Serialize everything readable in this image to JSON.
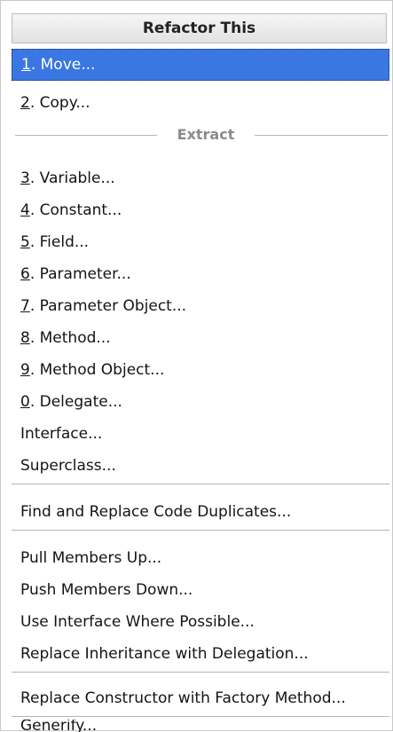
{
  "menu": {
    "title": "Refactor This",
    "items": [
      {
        "hotkey": "1",
        "label": ". Move..."
      },
      {
        "hotkey": "2",
        "label": ". Copy..."
      },
      {
        "hotkey": "3",
        "label": ". Variable..."
      },
      {
        "hotkey": "4",
        "label": ". Constant..."
      },
      {
        "hotkey": "5",
        "label": ". Field..."
      },
      {
        "hotkey": "6",
        "label": ". Parameter..."
      },
      {
        "hotkey": "7",
        "label": ". Parameter Object..."
      },
      {
        "hotkey": "8",
        "label": ". Method..."
      },
      {
        "hotkey": "9",
        "label": ". Method Object..."
      },
      {
        "hotkey": "0",
        "label": ". Delegate..."
      },
      {
        "hotkey": "",
        "label": "Interface..."
      },
      {
        "hotkey": "",
        "label": "Superclass..."
      },
      {
        "hotkey": "",
        "label": "Find and Replace Code Duplicates..."
      },
      {
        "hotkey": "",
        "label": "Pull Members Up..."
      },
      {
        "hotkey": "",
        "label": "Push Members Down..."
      },
      {
        "hotkey": "",
        "label": "Use Interface Where Possible..."
      },
      {
        "hotkey": "",
        "label": "Replace Inheritance with Delegation..."
      },
      {
        "hotkey": "",
        "label": "Replace Constructor with Factory Method..."
      },
      {
        "hotkey": "",
        "label": "Generify..."
      }
    ],
    "extract_label": "Extract",
    "selected_index": 0
  },
  "colors": {
    "selection": "#3a77e3",
    "separator": "#b5b5b5",
    "group_label": "#8a8a8a"
  }
}
